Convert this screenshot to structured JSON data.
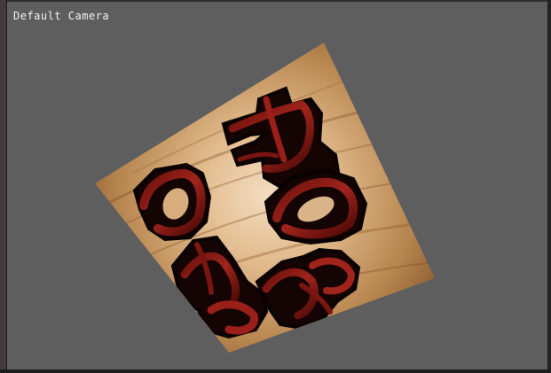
{
  "viewport": {
    "camera_label": "Default Camera"
  },
  "scene": {
    "object": "textured-quad",
    "texture_name": "wood-grain-texture",
    "decal_name": "red-glyph-decals"
  },
  "colors": {
    "background": "#5e5e5e",
    "wood_light": "#e8c7a0",
    "wood_dark": "#9a6a3e",
    "glyph_dark": "#1a0505",
    "glyph_red": "#8a1a14"
  }
}
